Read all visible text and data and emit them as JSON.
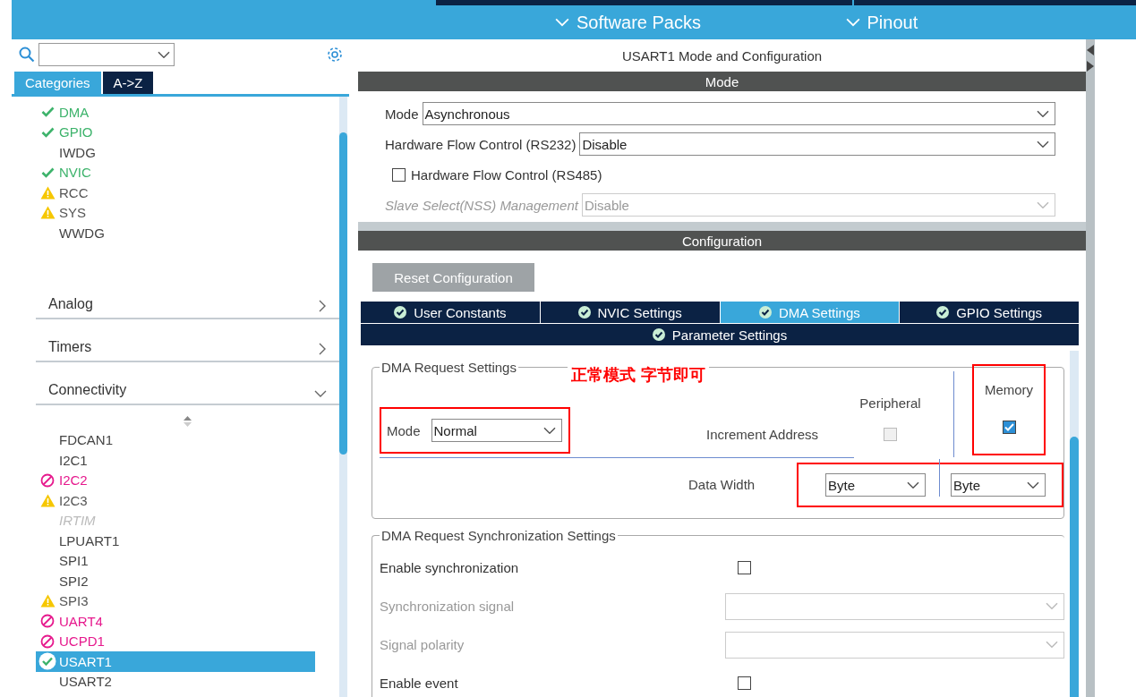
{
  "top_nav": [
    {
      "label": "Software Packs"
    },
    {
      "label": "Pinout"
    }
  ],
  "sidebar": {
    "tabs": [
      {
        "label": "Categories",
        "selected": true
      },
      {
        "label": "A->Z",
        "selected": false
      }
    ],
    "system_items": [
      {
        "label": "DMA",
        "kind": "ok",
        "selected": false
      },
      {
        "label": "GPIO",
        "kind": "ok",
        "selected": false
      },
      {
        "label": "IWDG",
        "kind": "none",
        "selected": false
      },
      {
        "label": "NVIC",
        "kind": "ok",
        "selected": false
      },
      {
        "label": "RCC",
        "kind": "warn",
        "selected": false
      },
      {
        "label": "SYS",
        "kind": "warn",
        "selected": false
      },
      {
        "label": "WWDG",
        "kind": "none",
        "selected": false
      }
    ],
    "categories": [
      {
        "label": "Analog",
        "expanded": false
      },
      {
        "label": "Timers",
        "expanded": false
      },
      {
        "label": "Connectivity",
        "expanded": true
      }
    ],
    "connectivity_items": [
      {
        "label": "FDCAN1",
        "kind": "none",
        "selected": false
      },
      {
        "label": "I2C1",
        "kind": "none",
        "selected": false
      },
      {
        "label": "I2C2",
        "kind": "error",
        "selected": false
      },
      {
        "label": "I2C3",
        "kind": "warn",
        "selected": false
      },
      {
        "label": "IRTIM",
        "kind": "disabled",
        "selected": false
      },
      {
        "label": "LPUART1",
        "kind": "none",
        "selected": false
      },
      {
        "label": "SPI1",
        "kind": "none",
        "selected": false
      },
      {
        "label": "SPI2",
        "kind": "none",
        "selected": false
      },
      {
        "label": "SPI3",
        "kind": "warn",
        "selected": false
      },
      {
        "label": "UART4",
        "kind": "error",
        "selected": false
      },
      {
        "label": "UCPD1",
        "kind": "error",
        "selected": false
      },
      {
        "label": "USART1",
        "kind": "ok",
        "selected": true
      },
      {
        "label": "USART2",
        "kind": "none",
        "selected": false
      }
    ]
  },
  "main": {
    "title": "USART1 Mode and Configuration",
    "mode_section": {
      "header": "Mode",
      "fields": [
        {
          "kind": "select",
          "label": "Mode",
          "value": "Asynchronous",
          "disabled": false
        },
        {
          "kind": "select",
          "label": "Hardware Flow Control (RS232)",
          "value": "Disable",
          "disabled": false
        },
        {
          "kind": "checkbox",
          "label": "Hardware Flow Control (RS485)",
          "checked": false
        },
        {
          "kind": "select",
          "label": "Slave Select(NSS) Management",
          "value": "Disable",
          "disabled": true
        }
      ]
    },
    "configuration": {
      "header": "Configuration",
      "reset_button": "Reset Configuration",
      "tabs": [
        {
          "label": "User Constants",
          "selected": false
        },
        {
          "label": "NVIC Settings",
          "selected": false
        },
        {
          "label": "DMA Settings",
          "selected": true
        },
        {
          "label": "GPIO Settings",
          "selected": false
        },
        {
          "label": "Parameter Settings",
          "selected": false
        }
      ],
      "dma_request": {
        "legend": "DMA Request Settings",
        "annotation": "正常模式 字节即可",
        "columns": [
          "Peripheral",
          "Memory"
        ],
        "mode": {
          "label": "Mode",
          "value": "Normal"
        },
        "increment": {
          "label": "Increment Address",
          "peripheral": false,
          "memory": true
        },
        "data_width": {
          "label": "Data Width",
          "peripheral": "Byte",
          "memory": "Byte"
        }
      },
      "sync": {
        "legend": "DMA Request Synchronization Settings",
        "rows": [
          {
            "kind": "checkbox",
            "label": "Enable synchronization",
            "checked": false
          },
          {
            "kind": "select",
            "label": "Synchronization signal",
            "disabled": true
          },
          {
            "kind": "select",
            "label": "Signal polarity",
            "disabled": true
          },
          {
            "kind": "checkbox",
            "label": "Enable event",
            "checked": false
          }
        ]
      }
    }
  }
}
